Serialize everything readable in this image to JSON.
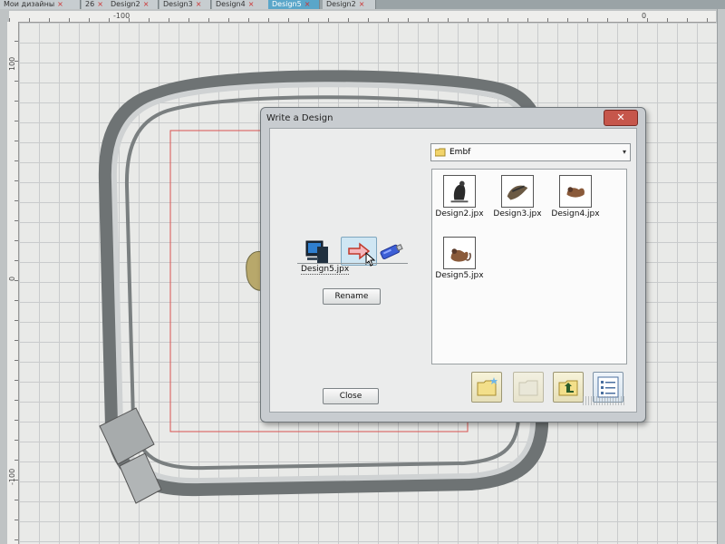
{
  "tabs": [
    {
      "label": "Мои дизайны",
      "active": false
    },
    {
      "label": "26",
      "active": false
    },
    {
      "label": "Design2",
      "active": false
    },
    {
      "label": "Design3",
      "active": false
    },
    {
      "label": "Design4",
      "active": false
    },
    {
      "label": "Design5",
      "active": true
    },
    {
      "label": "Design2",
      "active": false
    }
  ],
  "ruler": {
    "top_label": "-100",
    "top_label_right": "0",
    "left_label_top": "100",
    "left_label_mid": "0",
    "left_label_bottom": "-100"
  },
  "dialog": {
    "title": "Write a Design",
    "close_glyph": "✕",
    "filename": "Design5.jpx",
    "rename_label": "Rename",
    "close_label": "Close",
    "folder": {
      "selected": "Embf",
      "caret": "▾"
    },
    "files": [
      {
        "name": "Design2.jpx",
        "icon": "embroidery-thumbnail-icon"
      },
      {
        "name": "Design3.jpx",
        "icon": "embroidery-thumbnail-icon"
      },
      {
        "name": "Design4.jpx",
        "icon": "embroidery-thumbnail-icon"
      },
      {
        "name": "Design5.jpx",
        "icon": "embroidery-thumbnail-icon"
      }
    ],
    "toolbar": [
      {
        "name": "new-folder-button",
        "icon": "new-folder-icon"
      },
      {
        "name": "open-folder-button",
        "icon": "folder-open-icon"
      },
      {
        "name": "up-folder-button",
        "icon": "folder-up-icon"
      },
      {
        "name": "view-details-button",
        "icon": "details-view-icon"
      }
    ]
  },
  "colors": {
    "active_tab": "#5aa6c9",
    "close_button": "#c6564b",
    "hoop": "#6e7374",
    "design_area_border": "#d9534f",
    "arrow_button": "#cfe6f3"
  }
}
